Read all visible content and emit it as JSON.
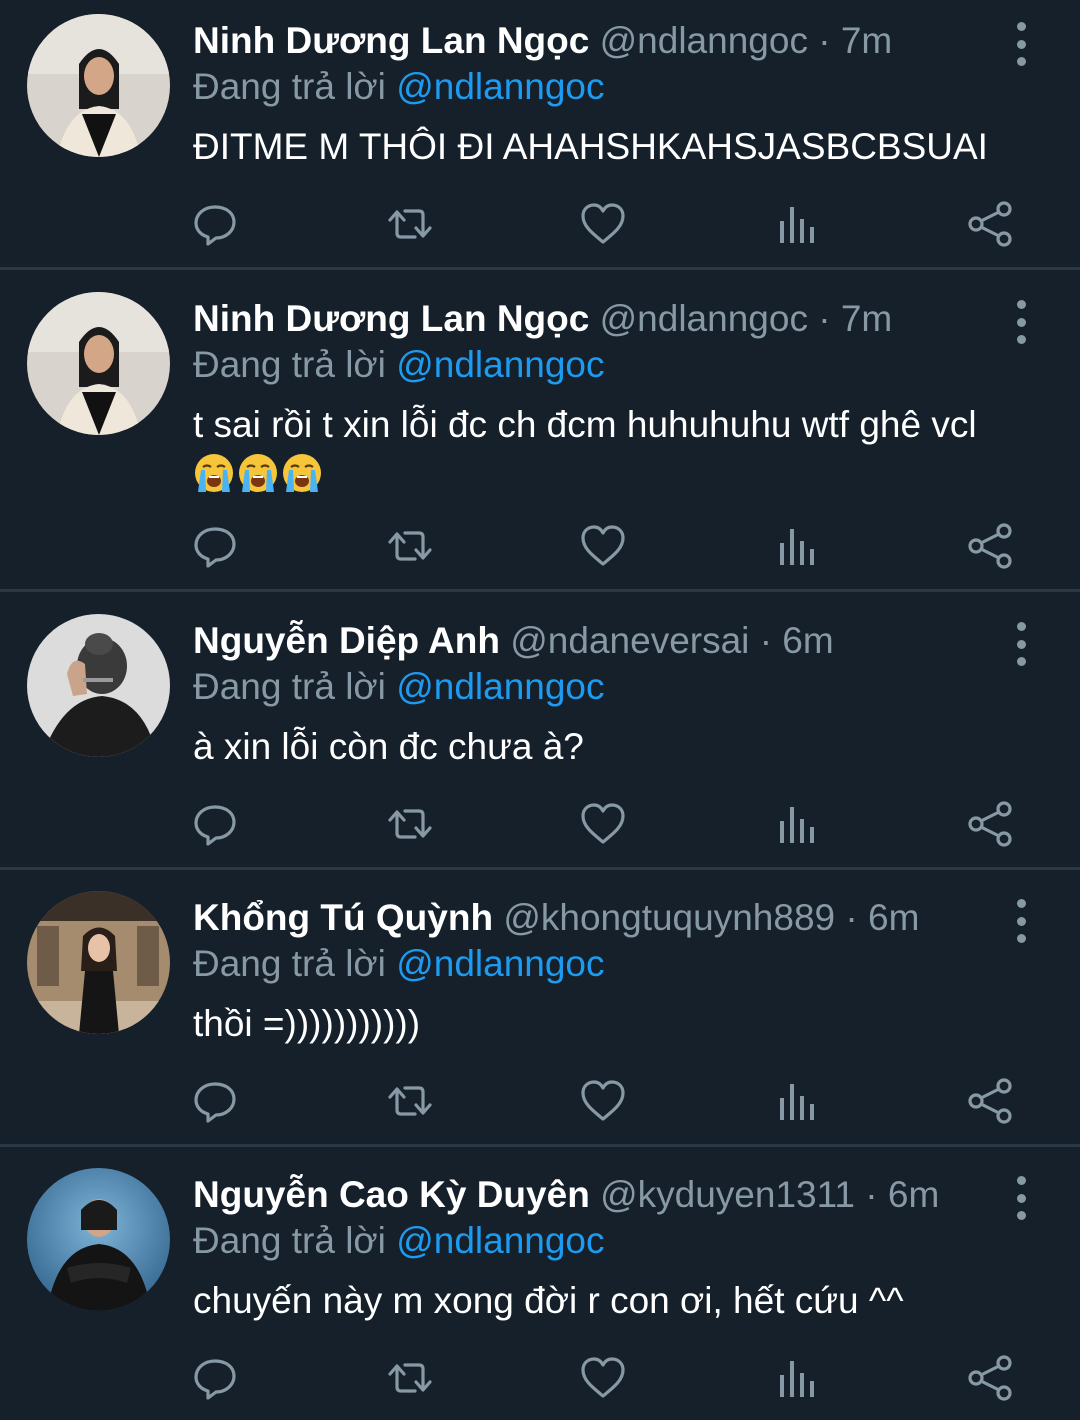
{
  "colors": {
    "background": "#15202b",
    "divider": "#2a3744",
    "muted": "#8899a6",
    "mention": "#1d9bf0",
    "text": "#ffffff"
  },
  "icons": {
    "reply": "reply-icon",
    "retweet": "retweet-icon",
    "like": "heart-icon",
    "stats": "analytics-icon",
    "share": "share-icon",
    "more": "more-vertical-icon"
  },
  "tweets": [
    {
      "display_name": "Ninh Dương Lan Ngọc",
      "handle": "@ndlanngoc",
      "separator": "·",
      "time": "7m",
      "reply_prefix": "Đang trả lời",
      "reply_to": "@ndlanngoc",
      "text": "ĐITME M THÔI ĐI AHAHSHKAHSJASBCBSUAI",
      "emoji": []
    },
    {
      "display_name": "Ninh Dương Lan Ngọc",
      "handle": "@ndlanngoc",
      "separator": "·",
      "time": "7m",
      "reply_prefix": "Đang trả lời",
      "reply_to": "@ndlanngoc",
      "text": "t sai rồi t xin lỗi đc ch đcm huhuhuhu wtf ghê vcl",
      "emoji": [
        "loudly-crying-face",
        "loudly-crying-face",
        "loudly-crying-face"
      ]
    },
    {
      "display_name": "Nguyễn Diệp Anh",
      "handle": "@ndaneversai",
      "separator": "·",
      "time": "6m",
      "reply_prefix": "Đang trả lời",
      "reply_to": "@ndlanngoc",
      "text": "à xin lỗi còn đc chưa à?",
      "emoji": []
    },
    {
      "display_name": "Khổng Tú Quỳnh",
      "handle": "@khongtuquynh889",
      "separator": "·",
      "time": "6m",
      "reply_prefix": "Đang trả lời",
      "reply_to": "@ndlanngoc",
      "text": "thồi =)))))))))))",
      "emoji": []
    },
    {
      "display_name": "Nguyễn Cao Kỳ Duyên",
      "handle": "@kyduyen1311",
      "separator": "·",
      "time": "6m",
      "reply_prefix": "Đang trả lời",
      "reply_to": "@ndlanngoc",
      "text": "chuyến này m xong đời r con ơi, hết cứu ^^",
      "emoji": []
    }
  ]
}
